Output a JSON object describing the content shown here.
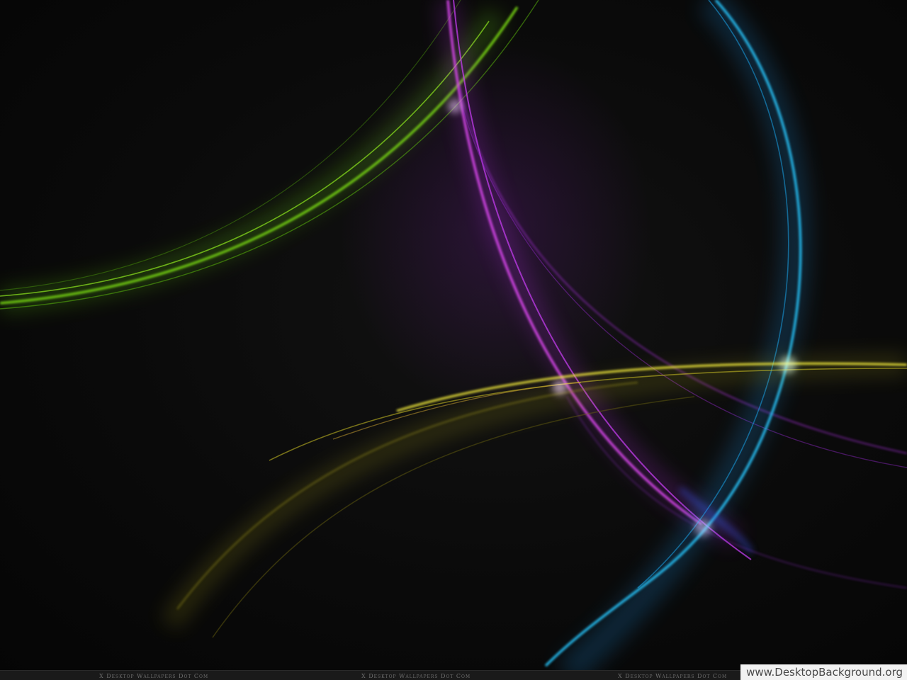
{
  "wallpaper": {
    "background_color": "#070707",
    "light_trails": [
      {
        "name": "green-trail",
        "color": "#7de016"
      },
      {
        "name": "magenta-trail",
        "color": "#d63cf0"
      },
      {
        "name": "cyan-trail",
        "color": "#1fb8f2"
      },
      {
        "name": "yellow-trail",
        "color": "#e8e036"
      }
    ]
  },
  "watermark": {
    "repeat_text": "X Desktop Wallpapers Dot Com",
    "site_url": "www.DesktopBackground.org"
  }
}
